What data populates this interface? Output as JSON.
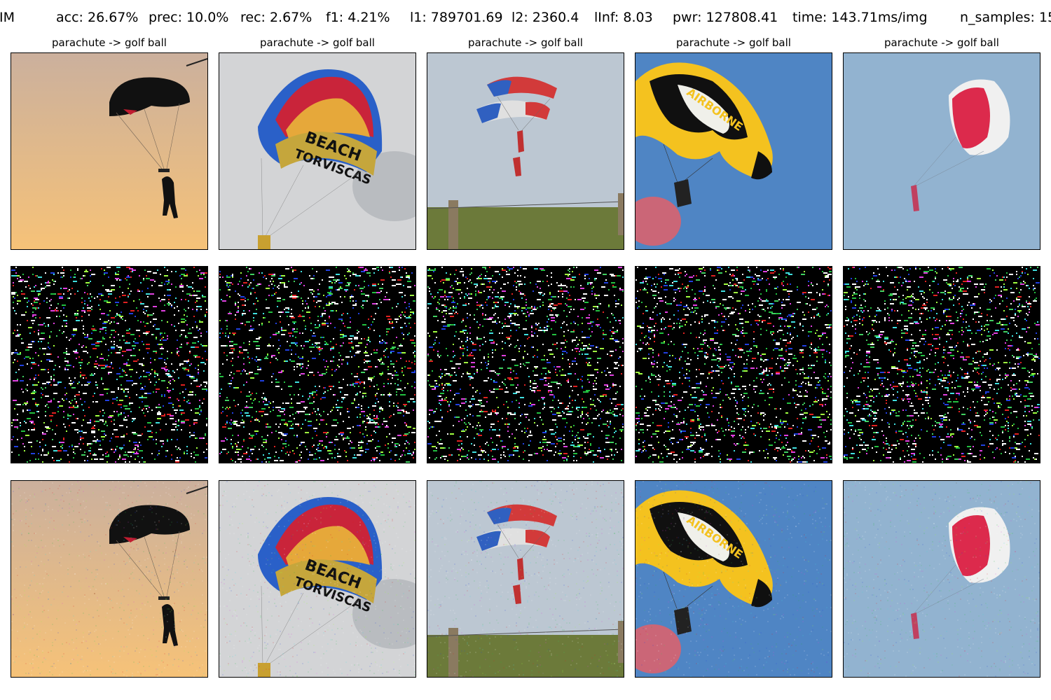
{
  "header": {
    "metrics": [
      {
        "id": "method",
        "label": "BIM"
      },
      {
        "id": "acc",
        "label": "acc: 26.67%"
      },
      {
        "id": "prec",
        "label": "prec: 10.0%"
      },
      {
        "id": "rec",
        "label": "rec: 2.67%"
      },
      {
        "id": "f1",
        "label": "f1: 4.21%"
      },
      {
        "id": "l1",
        "label": "l1: 789701.69"
      },
      {
        "id": "l2",
        "label": "l2: 2360.4"
      },
      {
        "id": "linf",
        "label": "lInf: 8.03"
      },
      {
        "id": "pwr",
        "label": "pwr: 127808.41"
      },
      {
        "id": "time",
        "label": "time: 143.71ms/img"
      },
      {
        "id": "n_samples",
        "label": "n_samples: 15"
      }
    ]
  },
  "columns": [
    {
      "title": "parachute -> golf ball",
      "scene": "silhouette-canopy",
      "sky": [
        "#cbb09d",
        "#f6c278"
      ],
      "canopy_colors": [
        "#111111",
        "#d01c3c"
      ]
    },
    {
      "title": "parachute -> golf ball",
      "scene": "rainbow-canopy",
      "canopy_text": "BEACH TORVISCAS",
      "sky": [
        "#d8d8d8",
        "#c4c7cb"
      ],
      "canopy_colors": [
        "#2a60c8",
        "#c9243a",
        "#e6a83a",
        "#3ea0c8",
        "#c5a63c"
      ]
    },
    {
      "title": "parachute -> golf ball",
      "scene": "tricolor-canopy-fence",
      "sky": [
        "#b5c2d0",
        "#c8d0d8"
      ],
      "canopy_colors": [
        "#e0e0e0",
        "#d23a3a",
        "#3060c0"
      ],
      "ground": "#6c7a3a"
    },
    {
      "title": "parachute -> golf ball",
      "scene": "airborne-canopy",
      "canopy_text": "AIRBORNE",
      "sky": [
        "#4a80c0",
        "#5a8cc8"
      ],
      "canopy_colors": [
        "#f4c21f",
        "#101010",
        "#f0f0ea"
      ],
      "smoke": "#e0606a"
    },
    {
      "title": "parachute -> golf ball",
      "scene": "red-white-canopy",
      "sky": [
        "#8fb1cf",
        "#98b6d3"
      ],
      "canopy_colors": [
        "#dc2a4c",
        "#f0f0f0"
      ]
    }
  ]
}
